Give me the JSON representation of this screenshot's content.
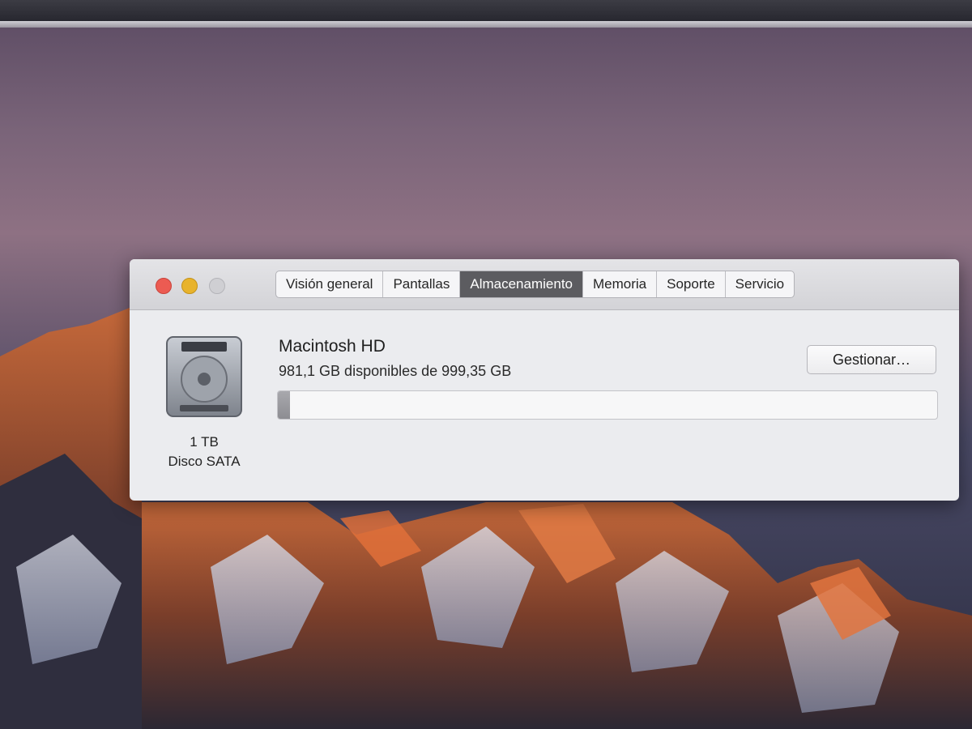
{
  "window": {
    "tabs": [
      {
        "label": "Visión general",
        "active": false
      },
      {
        "label": "Pantallas",
        "active": false
      },
      {
        "label": "Almacenamiento",
        "active": true
      },
      {
        "label": "Memoria",
        "active": false
      },
      {
        "label": "Soporte",
        "active": false
      },
      {
        "label": "Servicio",
        "active": false
      }
    ]
  },
  "disk": {
    "icon": "hard-drive-icon",
    "size": "1 TB",
    "type": "Disco SATA"
  },
  "volume": {
    "name": "Macintosh HD",
    "availability": "981,1 GB disponibles de 999,35 GB",
    "used_fraction": 0.018,
    "manage_label": "Gestionar…"
  },
  "colors": {
    "close": "#ec5b52",
    "minimize": "#e8b32c",
    "active_tab": "#5c5c60"
  }
}
